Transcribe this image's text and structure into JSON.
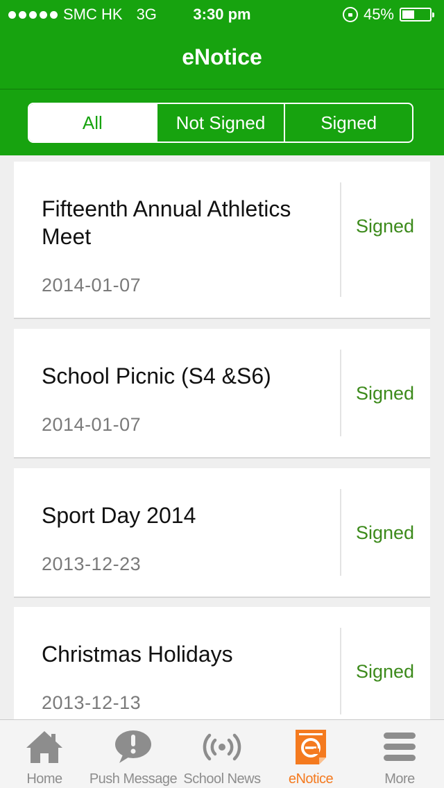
{
  "status_bar": {
    "carrier": "SMC HK",
    "network": "3G",
    "time": "3:30 pm",
    "battery": "45%",
    "battery_level": 0.45
  },
  "nav": {
    "title": "eNotice"
  },
  "segments": [
    "All",
    "Not Signed",
    "Signed"
  ],
  "notices": [
    {
      "title": "Fifteenth Annual Athletics Meet",
      "date": "2014-01-07",
      "status": "Signed"
    },
    {
      "title": "School Picnic (S4 &S6)",
      "date": "2014-01-07",
      "status": "Signed"
    },
    {
      "title": "Sport Day 2014",
      "date": "2013-12-23",
      "status": "Signed"
    },
    {
      "title": "Christmas Holidays",
      "date": "2013-12-13",
      "status": "Signed"
    }
  ],
  "tabs": [
    {
      "label": "Home",
      "icon": "home-icon"
    },
    {
      "label": "Push Message",
      "icon": "speech-bubble-icon"
    },
    {
      "label": "School News",
      "icon": "broadcast-icon"
    },
    {
      "label": "eNotice",
      "icon": "notice-document-icon"
    },
    {
      "label": "More",
      "icon": "menu-icon"
    }
  ],
  "colors": {
    "brand_green": "#17a30f",
    "status_green": "#3c8a1b",
    "active_tab_orange": "#f47a1f",
    "inactive_tab_gray": "#8d8d8d"
  }
}
